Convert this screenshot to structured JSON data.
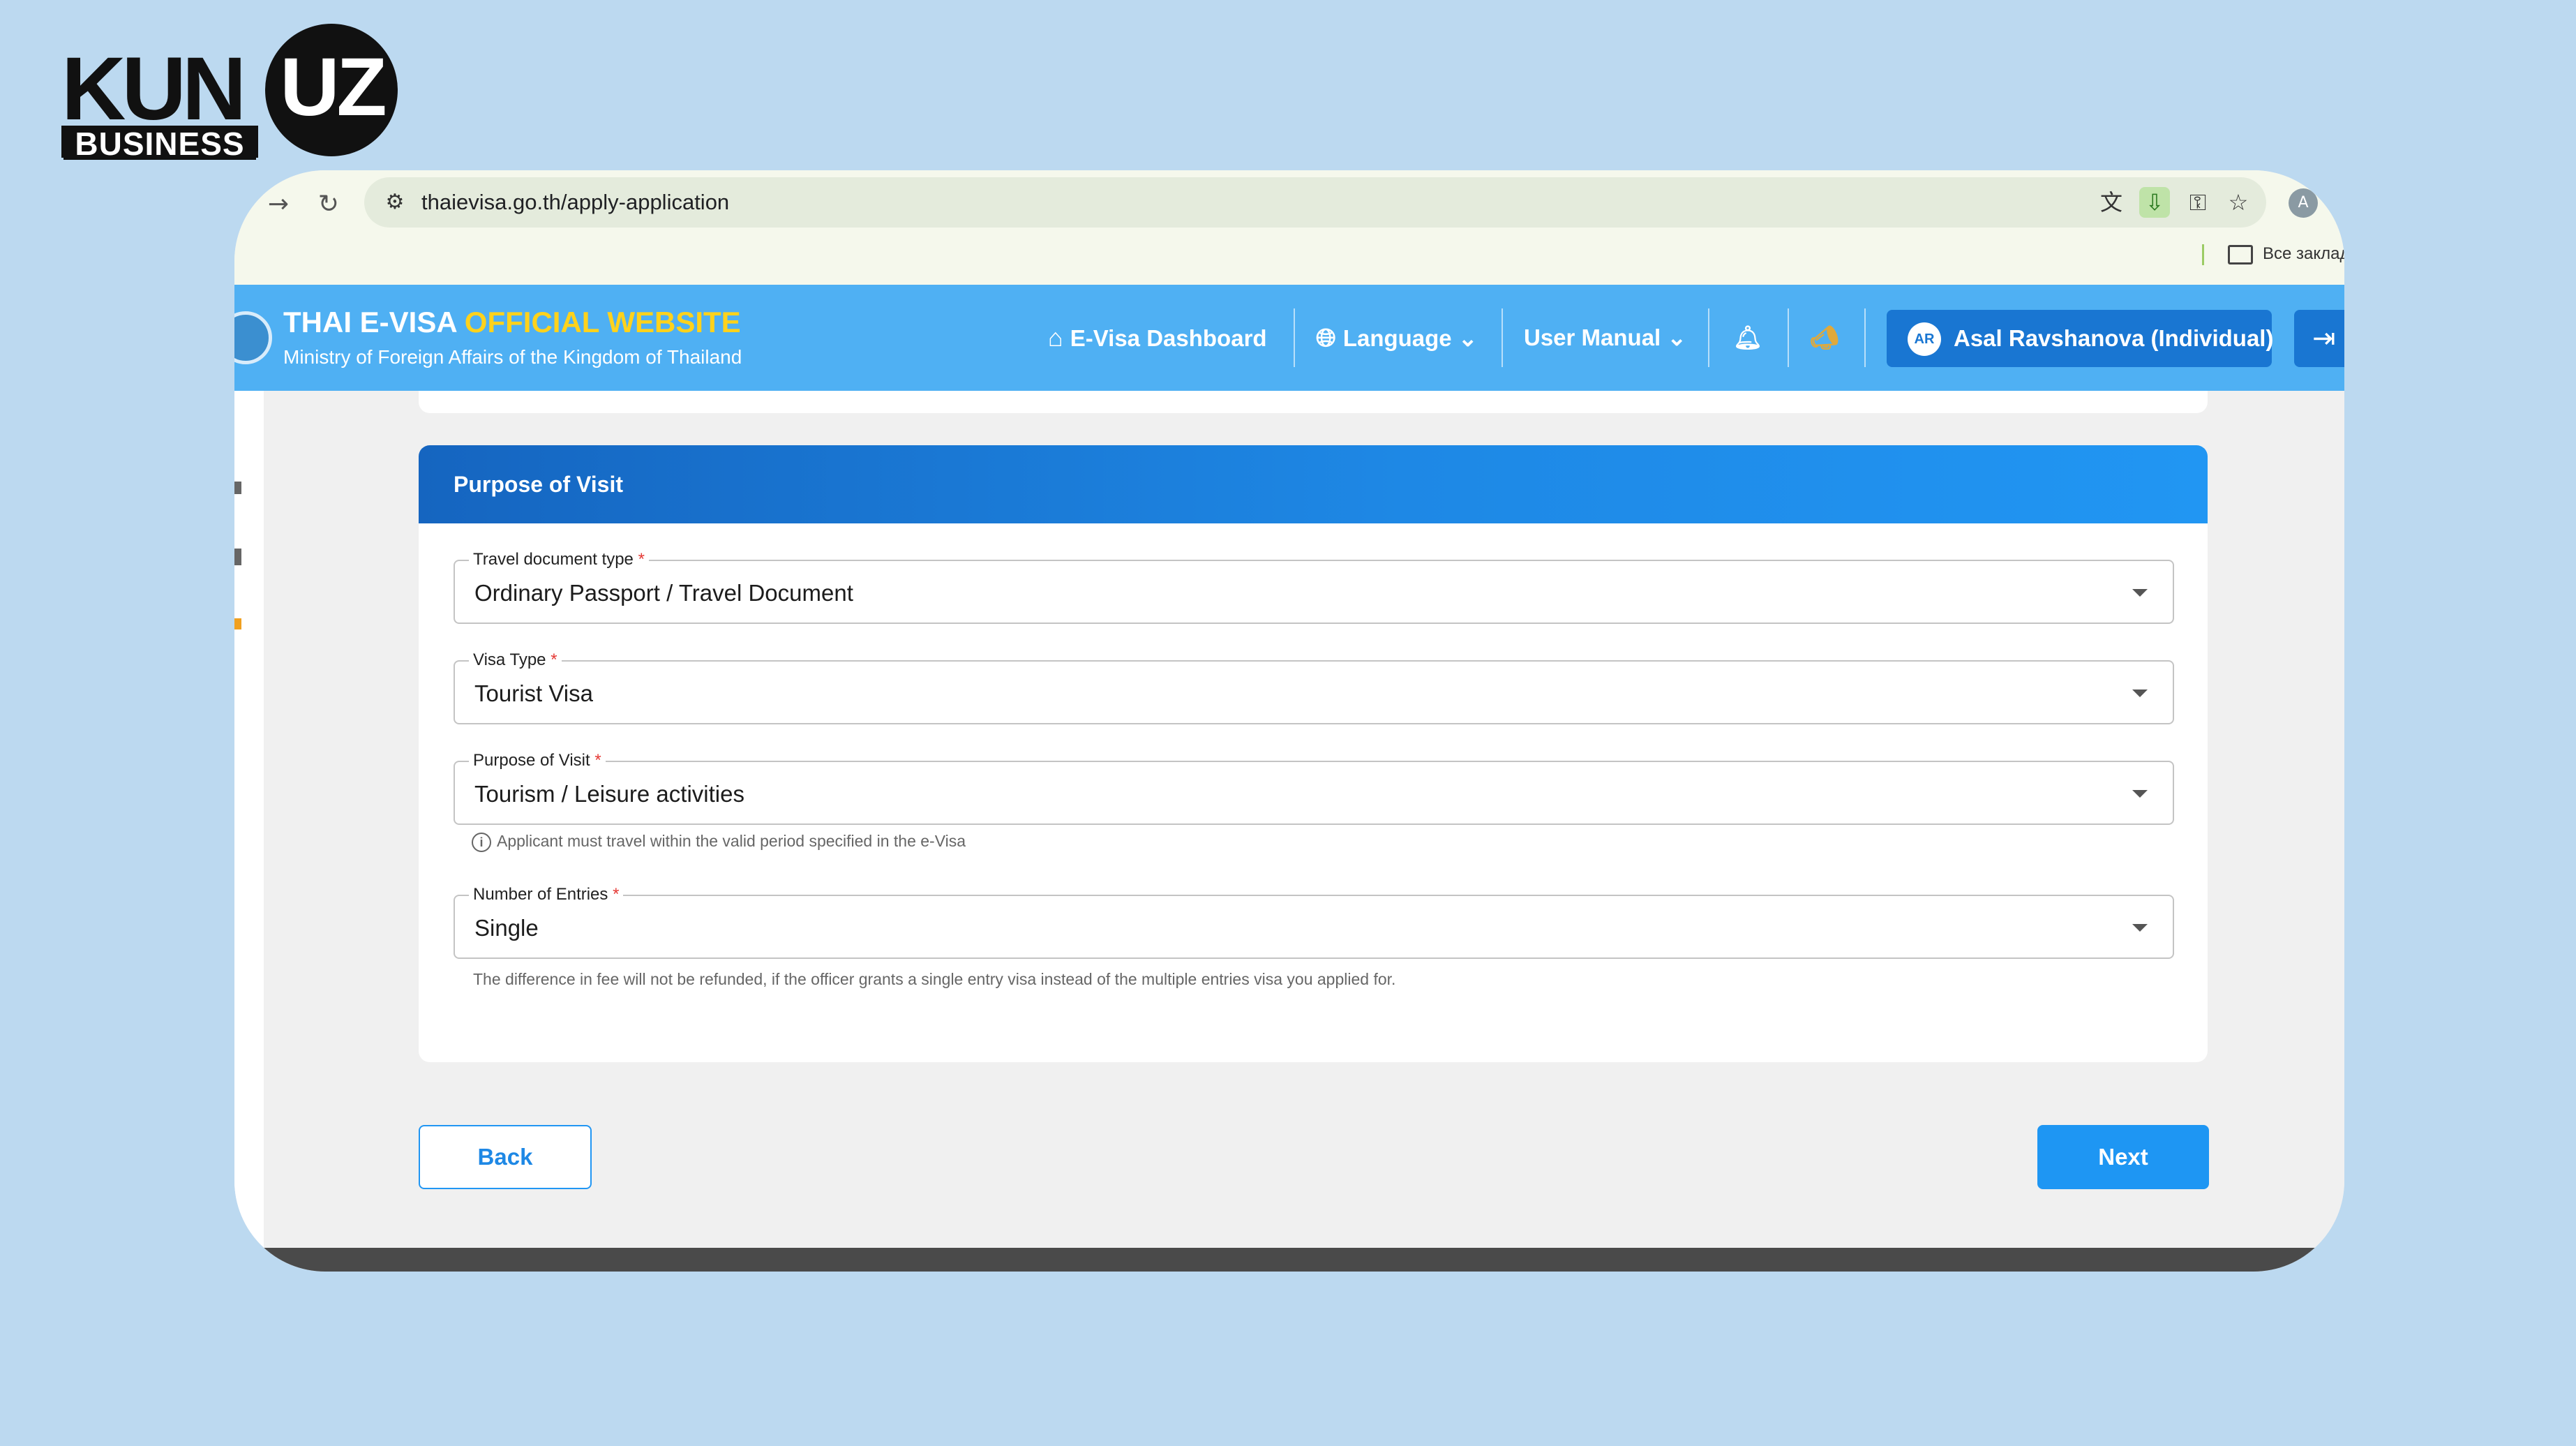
{
  "logo": {
    "kun": "KUN",
    "dot": ".",
    "uz": "UZ",
    "business": "BUSINESS"
  },
  "browser": {
    "url": "thaievisa.go.th/apply-application",
    "bookmarks_label": "Все заклад",
    "profile_initial": "A"
  },
  "site": {
    "title_main": "THAI E-VISA ",
    "title_accent": "OFFICIAL WEBSITE",
    "subtitle": "Ministry of Foreign Affairs of the Kingdom of Thailand",
    "accent_color": "#ffd21c",
    "nav": {
      "dashboard": "E-Visa Dashboard",
      "language": "Language",
      "user_manual": "User Manual"
    },
    "user": {
      "initials": "AR",
      "name": "Asal Ravshanova (Individual)"
    }
  },
  "form": {
    "section_title": "Purpose of Visit",
    "fields": [
      {
        "label": "Travel document type",
        "required": "*",
        "value": "Ordinary Passport / Travel Document"
      },
      {
        "label": "Visa Type",
        "required": "*",
        "value": "Tourist Visa"
      },
      {
        "label": "Purpose of Visit",
        "required": "*",
        "value": "Tourism / Leisure activities"
      },
      {
        "label": "Number of Entries",
        "required": "*",
        "value": "Single"
      }
    ],
    "purpose_hint": "Applicant must travel within the valid period specified in the e-Visa",
    "entries_hint": "The difference in fee will not be refunded, if the officer grants a single entry visa instead of the multiple entries visa you applied for."
  },
  "actions": {
    "back": "Back",
    "next": "Next"
  },
  "colors": {
    "page_background": "#bcd9f0",
    "header_blue": "#4fb0f3",
    "primary": "#1e96f3"
  }
}
